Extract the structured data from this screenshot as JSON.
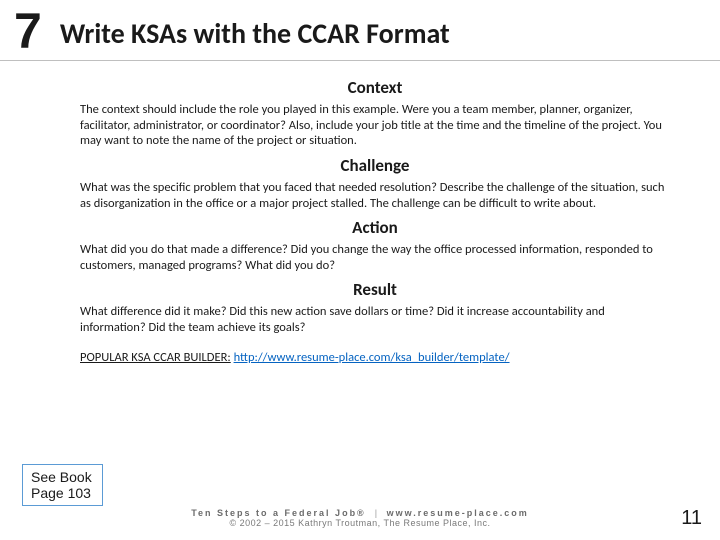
{
  "header": {
    "step_number": "7",
    "title": "Write KSAs with the CCAR Format"
  },
  "sections": [
    {
      "heading": "Context",
      "body": "The context should include the role you played in this example. Were you a team member, planner, organizer, facilitator, administrator, or coordinator? Also, include your job title at the time and the timeline of the project. You may want to note the name of the project or situation."
    },
    {
      "heading": "Challenge",
      "body": "What was the specific problem that you faced that needed resolution? Describe the challenge of the situation, such as disorganization in the office or a major project stalled. The challenge can be difficult to write about."
    },
    {
      "heading": "Action",
      "body": "What did you do that made a difference? Did you change the way the office processed information, responded to customers, managed programs? What did you do?"
    },
    {
      "heading": "Result",
      "body": "What difference did it make? Did this new action save dollars or time? Did it increase accountability and information? Did the team achieve its goals?"
    }
  ],
  "link": {
    "label": "POPULAR KSA CCAR BUILDER:",
    "url": "http://www.resume-place.com/ksa_builder/template/"
  },
  "book_ref": {
    "line1": "See Book",
    "line2": "Page 103"
  },
  "footer": {
    "brand_line1": "Ten Steps to a Federal Job®",
    "brand_sep": "|",
    "brand_line2": "www.resume-place.com",
    "copyright": "© 2002 – 2015 Kathryn Troutman, The Resume Place, Inc."
  },
  "page_number": "11"
}
